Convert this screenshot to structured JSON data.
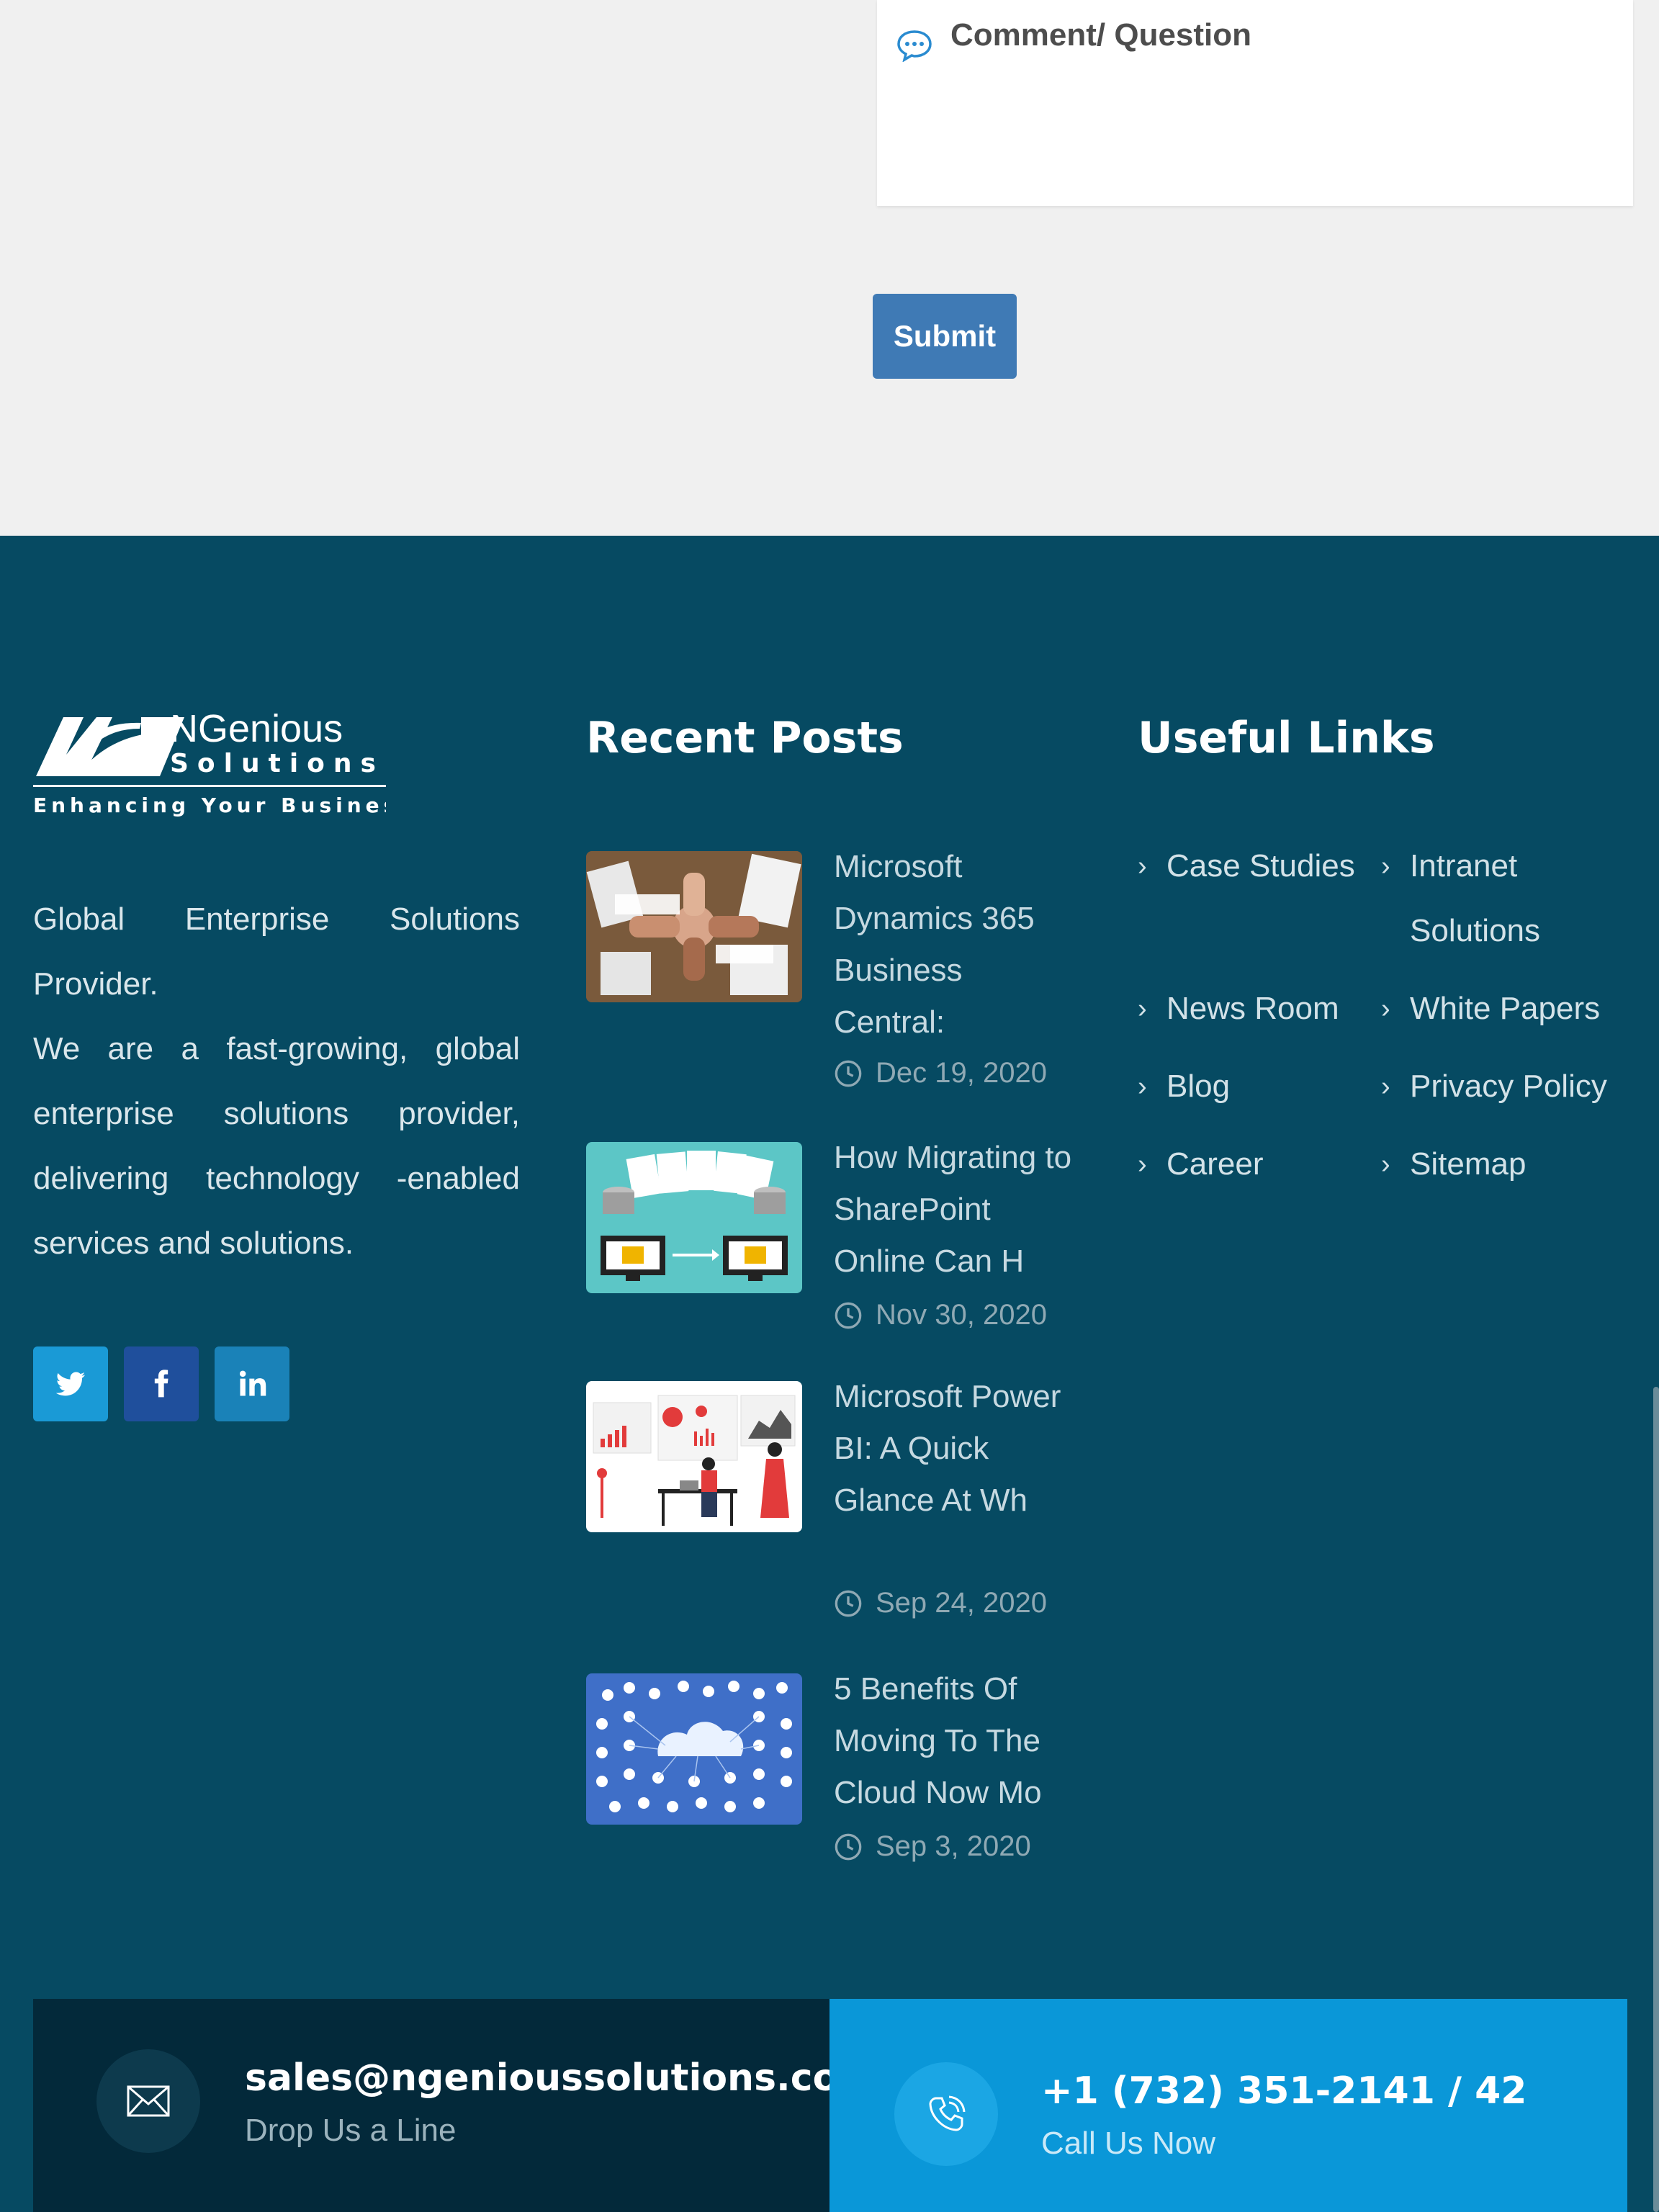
{
  "form": {
    "comment_label": "Comment/ Question",
    "submit_label": "Submit"
  },
  "footer": {
    "logo": {
      "name": "NGenious",
      "sub": "Solutions",
      "tagline": "Enhancing Your Business"
    },
    "about": {
      "line1": "Global Enterprise Solutions Provider.",
      "line2": "We are a fast-growing, global enterprise solutions provider, delivering technology -enabled services and solutions."
    },
    "social": [
      {
        "icon": "twitter-icon",
        "color": "#1a9ad6"
      },
      {
        "icon": "facebook-icon",
        "color": "#1f4f9c"
      },
      {
        "icon": "linkedin-icon",
        "color": "#1a82b8"
      }
    ],
    "recent_posts": {
      "title": "Recent Posts",
      "posts": [
        {
          "title": "Microsoft Dynamics 365 Business Central:",
          "date": "Dec 19, 2020"
        },
        {
          "title": "How Migrating to SharePoint Online Can H",
          "date": "Nov 30, 2020"
        },
        {
          "title": "Microsoft Power BI: A Quick Glance At Wh",
          "date": "Sep 24, 2020"
        },
        {
          "title": "5 Benefits Of Moving To The Cloud Now Mo",
          "date": "Sep 3, 2020"
        }
      ]
    },
    "useful_links": {
      "title": "Useful Links",
      "left": [
        "Case Studies",
        "News Room",
        "Blog",
        "Career"
      ],
      "right": [
        "Intranet Solutions",
        "White Papers",
        "Privacy Policy",
        "Sitemap"
      ]
    },
    "contact": {
      "email": "sales@ngenioussolutions.com",
      "email_sub": "Drop Us a Line",
      "phone": "+1 (732) 351-2141 / 42",
      "phone_sub": "Call Us Now"
    }
  },
  "colors": {
    "footer_bg": "#064a62",
    "submit": "#3f7ab5",
    "contact_left": "#03293a",
    "contact_right": "#0a97d8"
  }
}
